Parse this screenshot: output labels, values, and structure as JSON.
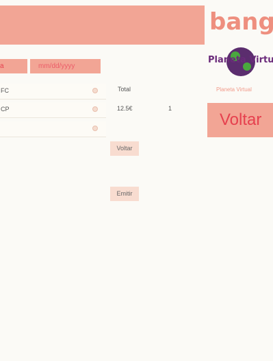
{
  "brand": {
    "text": "bang"
  },
  "dates": {
    "start_partial": "a",
    "end_placeholder": "mm/dd/yyyy"
  },
  "list": [
    {
      "label": "FC"
    },
    {
      "label": "CP"
    },
    {
      "label": ""
    }
  ],
  "summary": {
    "total_label": "Total",
    "total_value": "12.5€",
    "quantity": "1"
  },
  "buttons": {
    "voltar": "Voltar",
    "emitir": "Emitir",
    "voltar_big": "Voltar"
  },
  "logo": {
    "text": "Planeta Virtual",
    "caption": "Planeta Virtual"
  },
  "colors": {
    "accent": "#f2a595",
    "accent_text": "#e6404e",
    "button_light": "#f8dcd0"
  }
}
